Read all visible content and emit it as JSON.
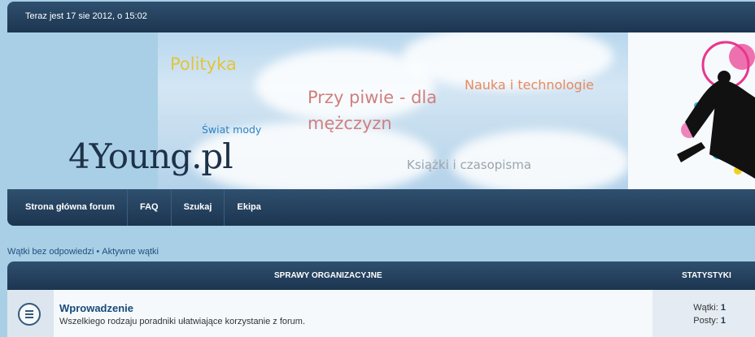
{
  "header": {
    "datetime": "Teraz jest 17 sie 2012, o 15:02"
  },
  "banner": {
    "logo": "4Young.pl",
    "keywords": {
      "polityka": "Polityka",
      "przy_piwie": "Przy piwie - dla mężczyzn",
      "nauka": "Nauka i technologie",
      "swiat_mody": "Świat mody",
      "ksiazki": "Książki i czasopisma"
    }
  },
  "nav": {
    "home": "Strona główna forum",
    "faq": "FAQ",
    "search": "Szukaj",
    "team": "Ekipa"
  },
  "quick_links": {
    "unanswered": "Wątki bez odpowiedzi",
    "separator": "•",
    "active": "Aktywne wątki"
  },
  "forum_table": {
    "category": "SPRAWY ORGANIZACYJNE",
    "stats_header": "STATYSTYKI",
    "forums": [
      {
        "title": "Wprowadzenie",
        "description": "Wszelkiego rodzaju poradniki ułatwiające korzystanie z forum.",
        "topics_label": "Wątki:",
        "topics": "1",
        "posts_label": "Posty:",
        "posts": "1",
        "icon": "forum-read-icon"
      }
    ]
  },
  "colors": {
    "background": "#a9cfe6",
    "bar_dark": "#1c3550",
    "link": "#1f4f7c"
  }
}
